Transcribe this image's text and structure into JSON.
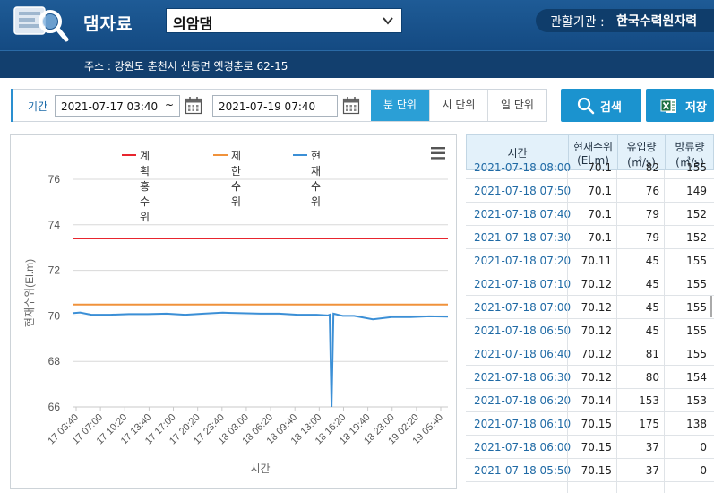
{
  "header": {
    "title": "댐자료",
    "dam_selected": "의암댐",
    "agency_label": "관할기관 :",
    "agency_name": "한국수력원자력"
  },
  "address": {
    "text": "주소 : 강원도 춘천시 신동면 옛경춘로 62-15"
  },
  "filter": {
    "period_label": "기간",
    "start_date": "2021-07-17 03:40",
    "range_sep": "~",
    "end_date": "2021-07-19 07:40",
    "units": [
      "분 단위",
      "시 단위",
      "일 단위"
    ],
    "active_unit": "분 단위"
  },
  "buttons": {
    "search": "검색",
    "save": "저장"
  },
  "colors": {
    "plan_flood": "#e8252e",
    "limit": "#f0923b",
    "current": "#3b8fd6",
    "accent": "#1b93cf"
  },
  "chart_data": {
    "type": "line",
    "ylabel": "현재수위(El.m)",
    "xlabel": "시간",
    "ylim": [
      66,
      76
    ],
    "yticks": [
      76,
      74,
      72,
      70,
      68,
      66
    ],
    "xticks": [
      "17 03:40",
      "17 07:00",
      "17 10:20",
      "17 13:40",
      "17 17:00",
      "17 20:20",
      "17 23:40",
      "18 03:00",
      "18 06:20",
      "18 09:40",
      "18 13:00",
      "18 16:20",
      "18 19:40",
      "18 23:00",
      "19 02:20",
      "19 05:40"
    ],
    "grid": true,
    "legend": "top",
    "series": [
      {
        "name": "계획홍수위",
        "color": "#e8252e",
        "x": [
          0,
          1
        ],
        "values": [
          73.4,
          73.4
        ]
      },
      {
        "name": "제한수위",
        "color": "#f0923b",
        "x": [
          0,
          1
        ],
        "values": [
          70.5,
          70.5
        ]
      },
      {
        "name": "현재수위",
        "color": "#3b8fd6",
        "x": [
          0,
          0.02,
          0.05,
          0.1,
          0.15,
          0.2,
          0.25,
          0.3,
          0.35,
          0.4,
          0.45,
          0.5,
          0.55,
          0.6,
          0.65,
          0.68,
          0.685,
          0.69,
          0.695,
          0.7,
          0.72,
          0.75,
          0.8,
          0.85,
          0.9,
          0.95,
          1.0
        ],
        "values": [
          70.12,
          70.15,
          70.05,
          70.05,
          70.08,
          70.08,
          70.1,
          70.05,
          70.1,
          70.14,
          70.12,
          70.1,
          70.1,
          70.05,
          70.05,
          70.02,
          70.05,
          66.0,
          70.1,
          70.08,
          70.0,
          70.0,
          69.85,
          69.95,
          69.95,
          69.98,
          69.97
        ]
      }
    ]
  },
  "table": {
    "headers": [
      [
        "시간"
      ],
      [
        "현재수위",
        "(El.m)"
      ],
      [
        "유입량",
        "(㎥/s)"
      ],
      [
        "방류량",
        "(㎥/s)"
      ]
    ],
    "rows": [
      [
        "2021-07-18 08:00",
        "70.1",
        "82",
        "155"
      ],
      [
        "2021-07-18 07:50",
        "70.1",
        "76",
        "149"
      ],
      [
        "2021-07-18 07:40",
        "70.1",
        "79",
        "152"
      ],
      [
        "2021-07-18 07:30",
        "70.1",
        "79",
        "152"
      ],
      [
        "2021-07-18 07:20",
        "70.11",
        "45",
        "155"
      ],
      [
        "2021-07-18 07:10",
        "70.12",
        "45",
        "155"
      ],
      [
        "2021-07-18 07:00",
        "70.12",
        "45",
        "155"
      ],
      [
        "2021-07-18 06:50",
        "70.12",
        "45",
        "155"
      ],
      [
        "2021-07-18 06:40",
        "70.12",
        "81",
        "155"
      ],
      [
        "2021-07-18 06:30",
        "70.12",
        "80",
        "154"
      ],
      [
        "2021-07-18 06:20",
        "70.14",
        "153",
        "153"
      ],
      [
        "2021-07-18 06:10",
        "70.15",
        "175",
        "138"
      ],
      [
        "2021-07-18 06:00",
        "70.15",
        "37",
        "0"
      ],
      [
        "2021-07-18 05:50",
        "70.15",
        "37",
        "0"
      ]
    ]
  }
}
